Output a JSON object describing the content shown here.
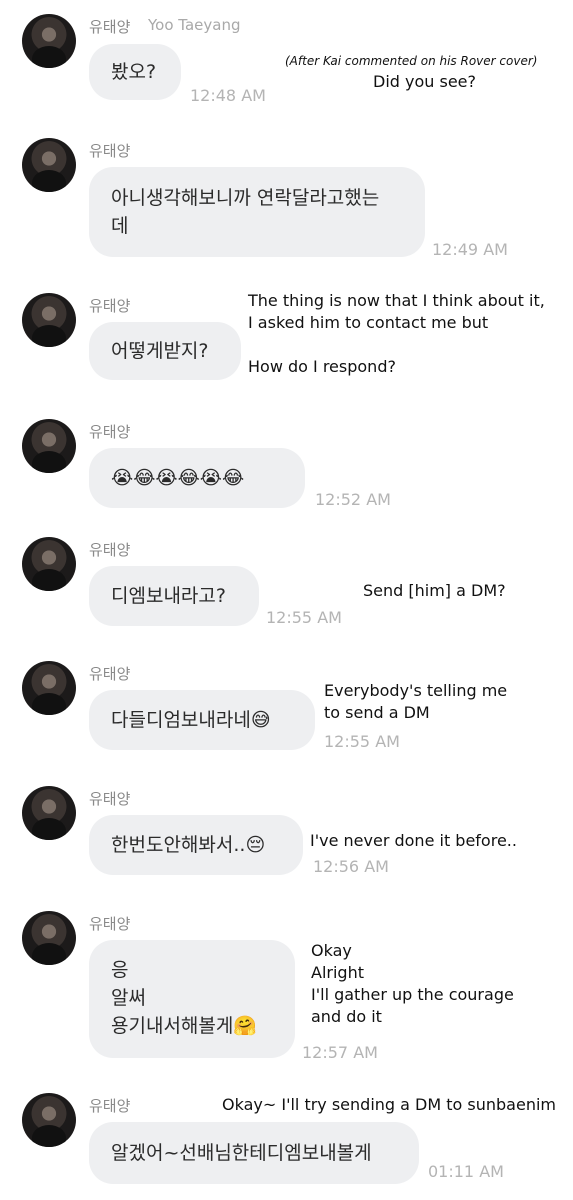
{
  "messages": [
    {
      "sender": "유태양",
      "sender_en": "Yoo Taeyang",
      "text": "봤오?",
      "time": "12:48 AM"
    },
    {
      "sender": "유태양",
      "text": "아니생각해보니까 연락달라고했는\n데",
      "time": "12:49 AM"
    },
    {
      "sender": "유태양",
      "text": "어떻게받지?",
      "time": ""
    },
    {
      "sender": "유태양",
      "text": "😭😂😭😂😭😂",
      "time": "12:52 AM"
    },
    {
      "sender": "유태양",
      "text": "디엠보내라고?",
      "time": "12:55 AM"
    },
    {
      "sender": "유태양",
      "text": "다들디엄보내라네😅",
      "time": "12:55 AM"
    },
    {
      "sender": "유태양",
      "text": "한번도안해봐서..😔",
      "time": "12:56 AM"
    },
    {
      "sender": "유태양",
      "text": "응\n알써\n용기내서해볼게🤗",
      "time": "12:57 AM"
    },
    {
      "sender": "유태양",
      "text": "알겠어~선배님한테디엠보내볼게",
      "time": "01:11 AM"
    }
  ],
  "annotations": {
    "a0_note": "(After Kai commented on his Rover cover)",
    "a0": "Did you see?",
    "a2": "The thing is now that I think about it,\nI asked him to contact me but\n\nHow do I respond?",
    "a4": "Send [him] a DM?",
    "a5": "Everybody's telling me\nto send a DM",
    "a6": "I've never done it before..",
    "a7": "Okay\nAlright\nI'll gather up the courage\nand do it",
    "a8": "Okay~ I'll try sending a DM to sunbaenim"
  }
}
